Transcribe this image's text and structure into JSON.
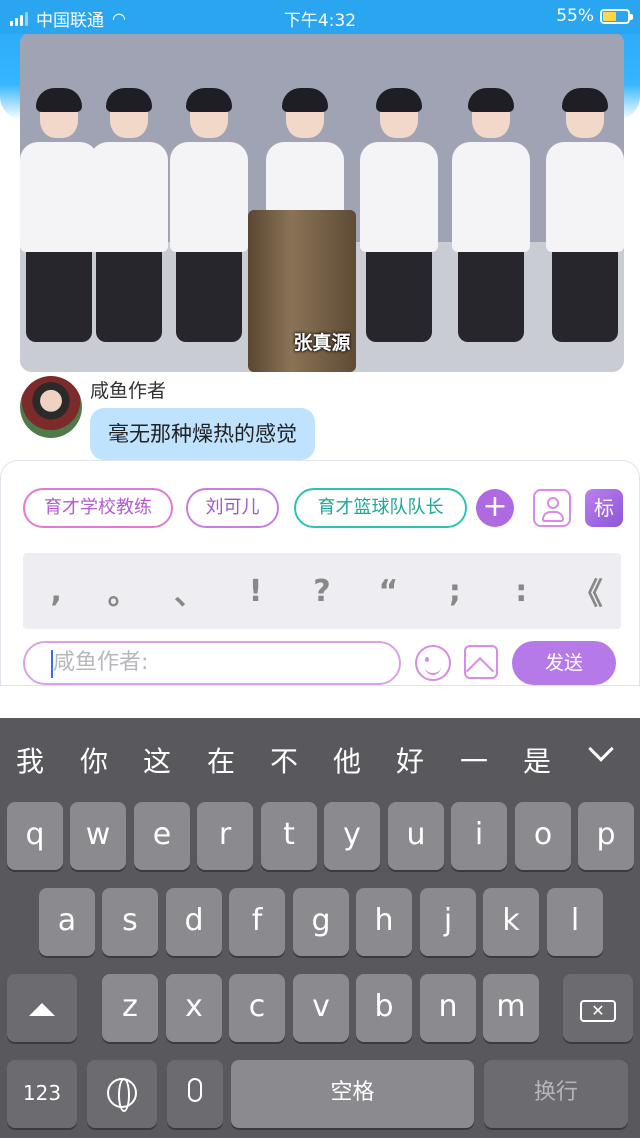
{
  "status_bar": {
    "carrier": "中国联通",
    "time": "下午4:32",
    "battery_percent": "55%",
    "battery_level": 0.55
  },
  "video": {
    "caption": "张真源"
  },
  "message": {
    "sender_name": "咸鱼作者",
    "text": "毫无那种燥热的感觉"
  },
  "tags": {
    "chip1": "育才学校教练",
    "chip2": "刘可儿",
    "chip3": "育才篮球队队长",
    "tag_button": "标"
  },
  "punctuation": [
    ",",
    "。",
    "、",
    "!",
    "?",
    "“",
    ";",
    ":",
    "《"
  ],
  "composer": {
    "placeholder": "咸鱼作者:",
    "send_label": "发送"
  },
  "keyboard": {
    "candidates": [
      "我",
      "你",
      "这",
      "在",
      "不",
      "他",
      "好",
      "一",
      "是"
    ],
    "row1": [
      "q",
      "w",
      "e",
      "r",
      "t",
      "y",
      "u",
      "i",
      "o",
      "p"
    ],
    "row2": [
      "a",
      "s",
      "d",
      "f",
      "g",
      "h",
      "j",
      "k",
      "l"
    ],
    "row3": [
      "z",
      "x",
      "c",
      "v",
      "b",
      "n",
      "m"
    ],
    "numbers_key": "123",
    "space_label": "空格",
    "return_label": "换行"
  },
  "colors": {
    "header_blue": "#2aa6f0",
    "send_purple": "#b57ae8",
    "bubble_blue": "#bfe3ff"
  }
}
